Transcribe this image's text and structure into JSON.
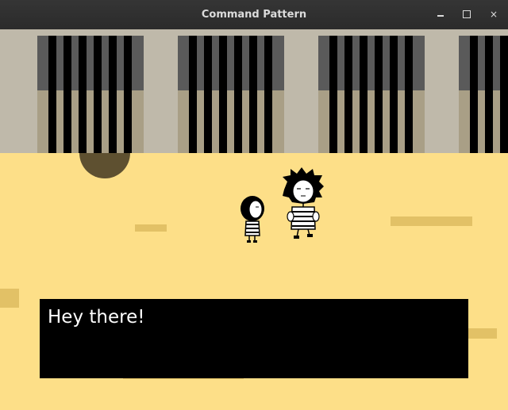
{
  "window": {
    "title": "Command Pattern",
    "minimize_glyph": "minimize-icon",
    "maximize_glyph": "maximize-icon",
    "close_label": "×"
  },
  "scene": {
    "colors": {
      "sand": "#fddf88",
      "sand_patch": "#e2c166",
      "wall": "#bfb9aa",
      "window_dark": "#5a5a5a",
      "window_light": "#a99f86",
      "shadow": "#5e5030",
      "dialog_bg": "#000000",
      "dialog_text": "#ffffff"
    },
    "characters": [
      {
        "name": "small-girl-character",
        "icon": "girl-sprite"
      },
      {
        "name": "spiky-haired-character",
        "icon": "spiky-hair-sprite"
      }
    ]
  },
  "dialog": {
    "text": "Hey there!"
  }
}
